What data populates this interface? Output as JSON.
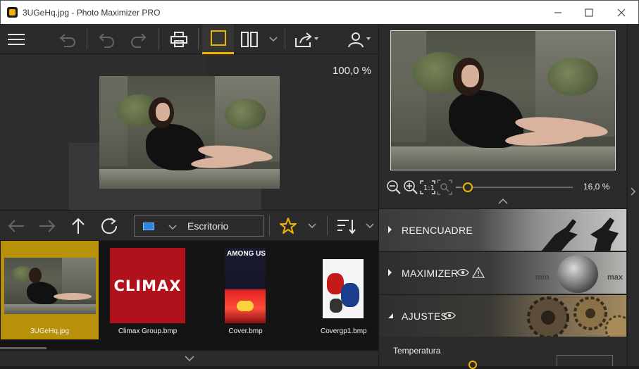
{
  "window": {
    "title": "3UGeHq.jpg - Photo Maximizer PRO"
  },
  "preview": {
    "zoom": "100,0 %"
  },
  "navigator": {
    "zoom": "16,0 %",
    "slider_level_pct": 3
  },
  "location": {
    "folder": "Escritorio"
  },
  "thumbnails": [
    {
      "name": "3UGeHq.jpg",
      "selected": true
    },
    {
      "name": "Climax Group.bmp",
      "selected": false,
      "logo_text": "CLIMAX"
    },
    {
      "name": "Cover.bmp",
      "selected": false,
      "logo_text": "AMONG US"
    },
    {
      "name": "Covergp1.bmp",
      "selected": false
    }
  ],
  "panels": [
    {
      "label": "REENCUADRE"
    },
    {
      "label": "MAXIMIZER",
      "dial_min": "min",
      "dial_max": "max"
    },
    {
      "label": "AJUSTES"
    }
  ],
  "ajustes": {
    "temperature_label": "Temperatura"
  },
  "colors": {
    "accent": "#f0b400",
    "selection": "#b8900a",
    "folder_icon": "#2a86e0"
  },
  "icons": {
    "menu": "hamburger-icon",
    "undo_all": "undo-all-icon",
    "undo": "undo-icon",
    "redo": "redo-icon",
    "print": "print-icon",
    "single_view": "single-view-icon",
    "split_view": "split-view-icon",
    "share": "share-icon",
    "user": "user-icon",
    "back": "arrow-left-icon",
    "forward": "arrow-right-icon",
    "up": "arrow-up-icon",
    "refresh": "refresh-icon",
    "favorite": "star-icon",
    "sort": "sort-icon"
  }
}
